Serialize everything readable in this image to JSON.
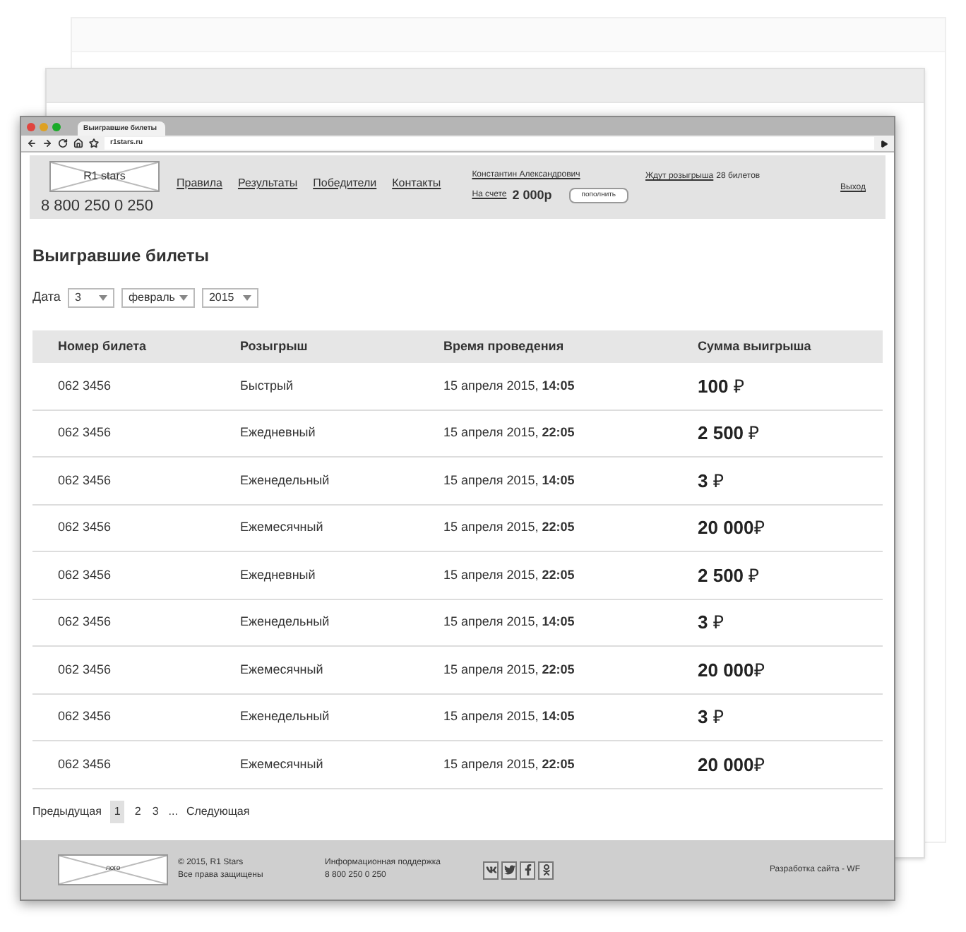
{
  "browser": {
    "tab_title": "Выигравшие билеты",
    "address": "r1stars.ru"
  },
  "header": {
    "logo": "R1 stars",
    "phone": "8 800 250 0 250",
    "nav": [
      "Правила",
      "Результаты",
      "Победители",
      "Контакты"
    ],
    "user_name": "Константин Александрович",
    "balance_label": "На счете",
    "balance": "2 000р",
    "topup_button": "пополнить",
    "waiting_link": "Ждут розыгрыша",
    "waiting_count": "28 билетов",
    "logout": "Выход"
  },
  "page_title": "Выигравшие билеты",
  "date_filter": {
    "label": "Дата",
    "day": "3",
    "month": "февраль",
    "year": "2015"
  },
  "table": {
    "columns": [
      "Номер билета",
      "Розыгрыш",
      "Время проведения",
      "Сумма выигрыша"
    ],
    "rows": [
      {
        "ticket": "062 3456",
        "draw": "Быстрый",
        "time": "15 апреля 2015, **14:05**",
        "amount": "**100** ₽"
      },
      {
        "ticket": "062 3456",
        "draw": "Ежедневный",
        "time": "15 апреля 2015, **22:05**",
        "amount": "**2 500** ₽"
      },
      {
        "ticket": "062 3456",
        "draw": "Еженедельный",
        "time": "15 апреля 2015, **14:05**",
        "amount": "**3** ₽"
      },
      {
        "ticket": "062 3456",
        "draw": "Ежемесячный",
        "time": "15 апреля 2015, **22:05**",
        "amount": "**20 000**₽"
      },
      {
        "ticket": "062 3456",
        "draw": "Ежедневный",
        "time": "15 апреля 2015, **22:05**",
        "amount": "**2 500** ₽"
      },
      {
        "ticket": "062 3456",
        "draw": "Еженедельный",
        "time": "15 апреля 2015, **14:05**",
        "amount": "**3** ₽"
      },
      {
        "ticket": "062 3456",
        "draw": "Ежемесячный",
        "time": "15 апреля 2015, **22:05**",
        "amount": "**20 000**₽"
      },
      {
        "ticket": "062 3456",
        "draw": "Еженедельный",
        "time": "15 апреля 2015, **14:05**",
        "amount": "**3** ₽"
      },
      {
        "ticket": "062 3456",
        "draw": "Ежемесячный",
        "time": "15 апреля 2015, **22:05**",
        "amount": "**20 000**₽"
      }
    ]
  },
  "pagination": {
    "previous": "Предыдущая",
    "pages": [
      {
        "label": "1",
        "selected": true
      },
      {
        "label": "2",
        "selected": false
      },
      {
        "label": "3",
        "selected": false
      }
    ],
    "ellipsis": "...",
    "next": "Следующая"
  },
  "footer": {
    "logo": "лого",
    "copyright": "© 2015, R1 Stars",
    "rights": "Все права защищены",
    "support_label": "Информационная поддержка",
    "support_phone": "8 800 250 0 250",
    "social": [
      {
        "kind": "vk"
      },
      {
        "kind": "twitter"
      },
      {
        "kind": "facebook"
      },
      {
        "kind": "ok"
      }
    ],
    "developer": "Разработка сайта - WF"
  }
}
